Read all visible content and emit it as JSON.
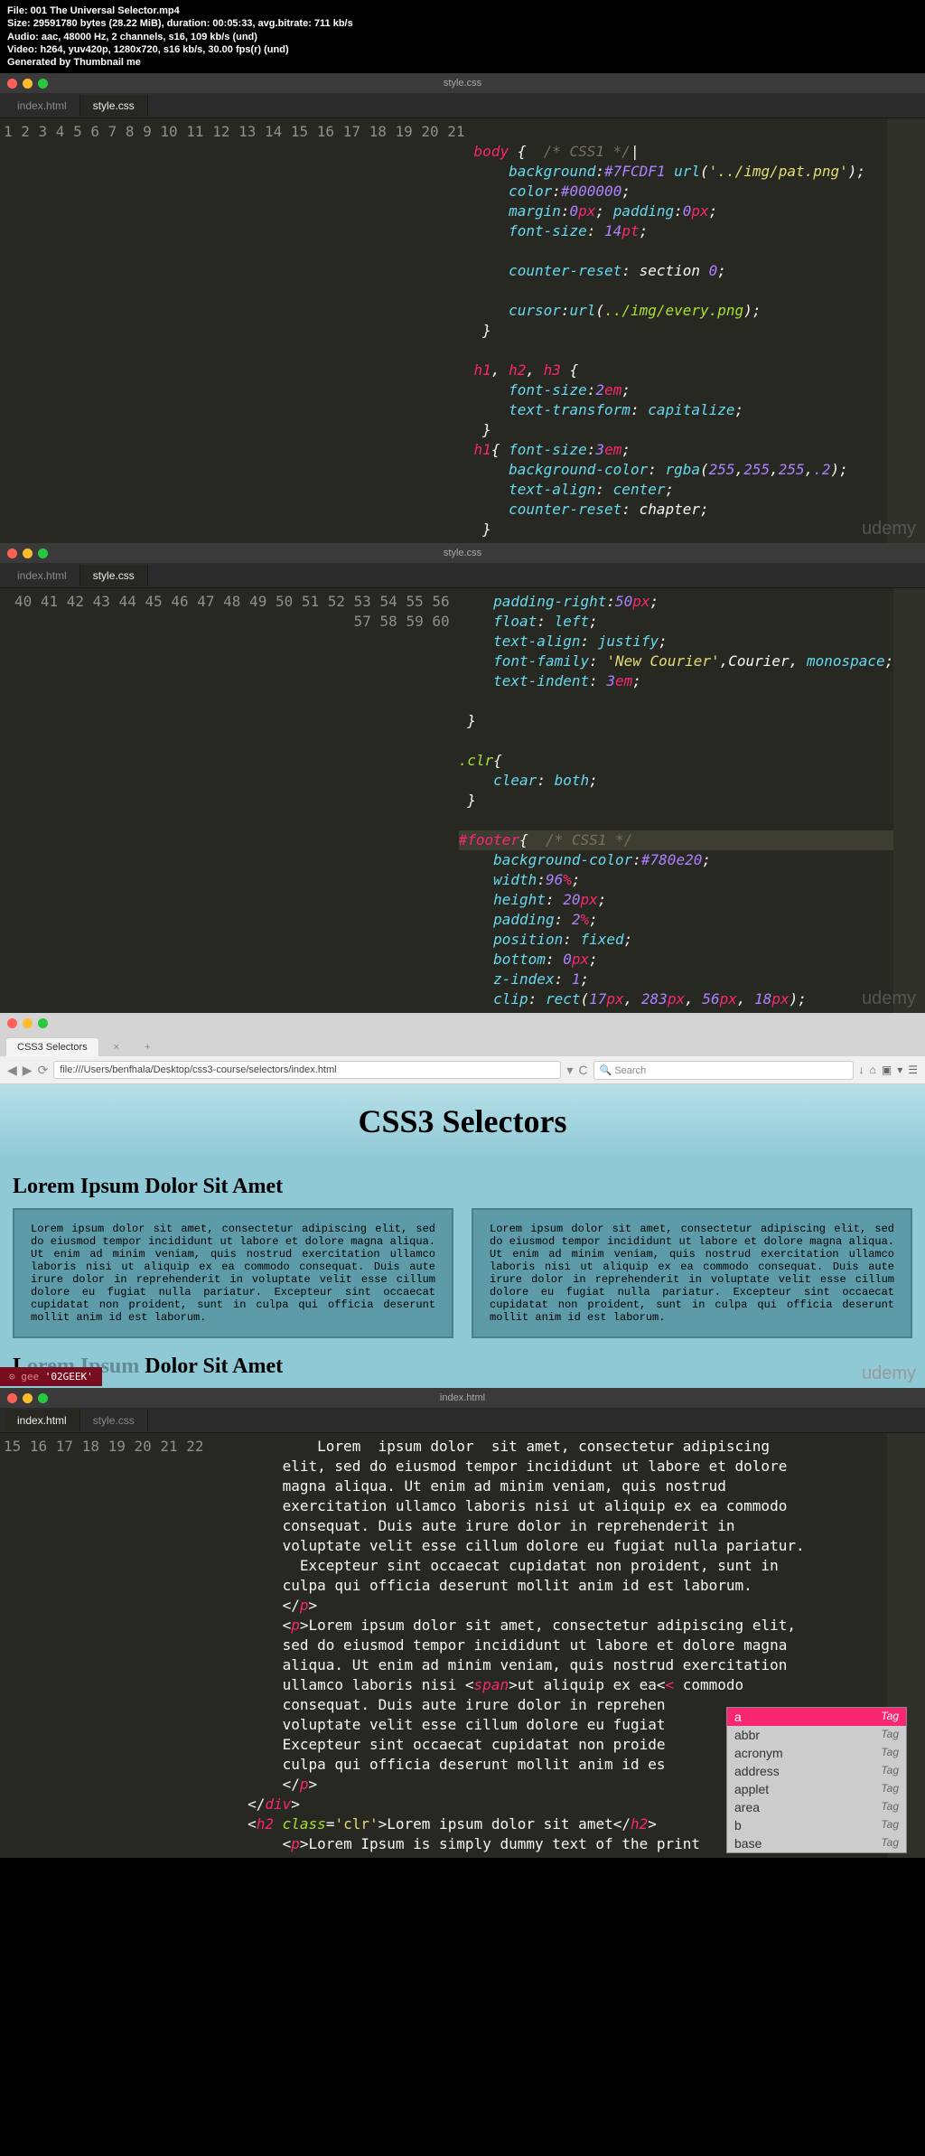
{
  "meta": {
    "file": "File: 001 The Universal Selector.mp4",
    "size": "Size: 29591780 bytes (28.22 MiB), duration: 00:05:33, avg.bitrate: 711 kb/s",
    "audio": "Audio: aac, 48000 Hz, 2 channels, s16, 109 kb/s (und)",
    "video": "Video: h264, yuv420p, 1280x720, s16 kb/s, 30.00 fps(r) (und)",
    "gen": "Generated by Thumbnail me"
  },
  "chrome": {
    "title": "style.css"
  },
  "tabs": {
    "t1": "index.html",
    "t2": "style.css",
    "t2b": "style.css"
  },
  "browser": {
    "tab": "CSS3 Selectors",
    "url": "file:///Users/benfhala/Desktop/css3-course/selectors/index.html",
    "search": "Search"
  },
  "page": {
    "title": "CSS3 Selectors",
    "sub1": "Lorem Ipsum Dolor Sit Amet",
    "sub2": "Dolor Sit Amet",
    "para": "    Lorem ipsum dolor sit amet, consectetur adipiscing elit, sed do eiusmod tempor incididunt ut labore et dolore magna aliqua. Ut enim ad minim veniam, quis nostrud exercitation ullamco laboris nisi ut aliquip ex ea commodo consequat. Duis aute irure dolor in reprehenderit in voluptate velit esse cillum dolore eu fugiat nulla pariatur. Excepteur sint occaecat cupidatat non proident, sunt in culpa qui officia deserunt mollit anim id est laborum.",
    "footer": "'02GEEK'"
  },
  "ac": {
    "a": "a",
    "abbr": "abbr",
    "acronym": "acronym",
    "address": "address",
    "applet": "applet",
    "area": "area",
    "b": "b",
    "base": "base",
    "tag": "Tag"
  },
  "wm": "udemy"
}
